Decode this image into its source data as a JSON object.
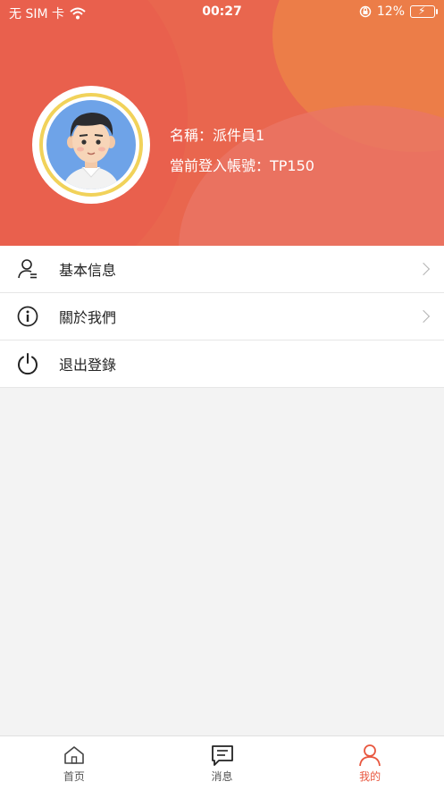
{
  "status_bar": {
    "carrier": "无 SIM 卡",
    "time": "00:27",
    "battery_percent": "12%"
  },
  "profile": {
    "name_line": "名稱：派件員1",
    "account_line": "當前登入帳號：TP150"
  },
  "menu": {
    "items": [
      {
        "label": "基本信息",
        "icon": "user-info-icon",
        "has_chevron": true
      },
      {
        "label": "關於我們",
        "icon": "info-icon",
        "has_chevron": true
      },
      {
        "label": "退出登錄",
        "icon": "power-icon",
        "has_chevron": false
      }
    ]
  },
  "tabbar": {
    "tabs": [
      {
        "label": "首页",
        "icon": "home-icon"
      },
      {
        "label": "消息",
        "icon": "message-icon"
      },
      {
        "label": "我的",
        "icon": "profile-icon"
      }
    ],
    "active_index": 2
  },
  "colors": {
    "header": "#e9664e",
    "accent": "#e8573f",
    "avatar_ring": "#f1d25a"
  }
}
